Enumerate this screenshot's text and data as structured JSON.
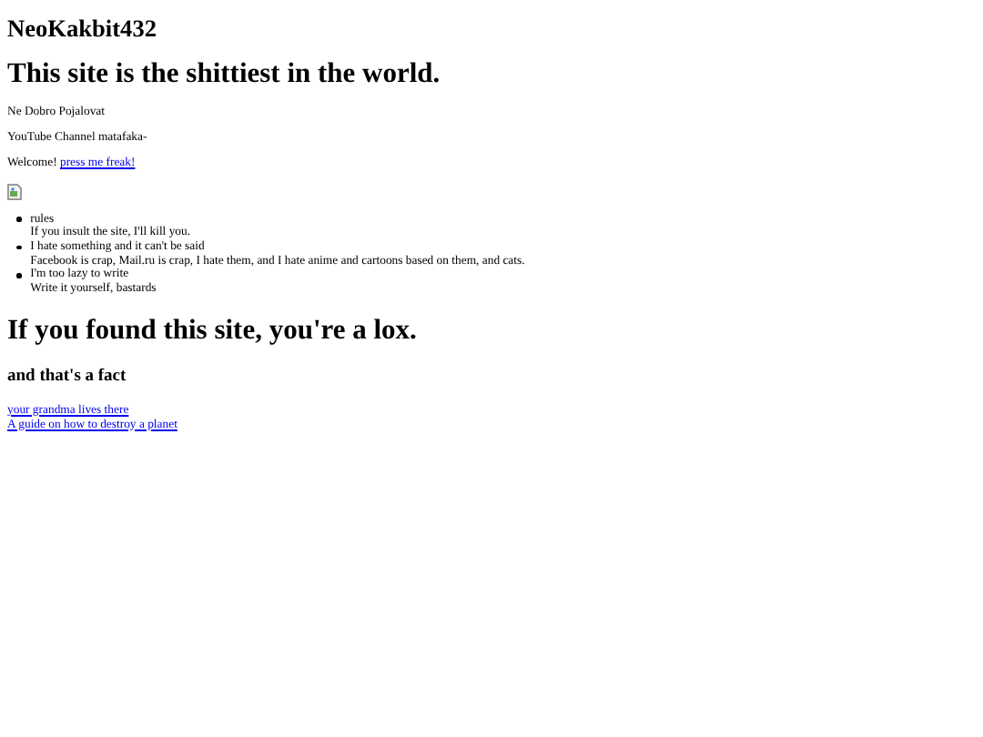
{
  "site_title": "NeoKakbit432",
  "headline": "This site is the shittiest in the world.",
  "paragraphs": [
    "Ne Dobro Pojalovat",
    "YouTube Channel matafaka-"
  ],
  "welcome": {
    "text": "Welcome!",
    "link": "press me freak!"
  },
  "list": [
    {
      "title": "rules",
      "text": "If you insult the site, I'll kill you."
    },
    {
      "title": "I hate something and it can't be said",
      "text": "Facebook is crap, Mail.ru is crap, I hate them, and I hate anime and cartoons based on them, and cats."
    },
    {
      "title": "I'm too lazy to write",
      "text": "Write it yourself, bastards"
    }
  ],
  "found_heading": "If you found this site, you're a lox.",
  "subheading": "and that's a fact",
  "links": [
    "your grandma lives there",
    "A guide on how to destroy a planet"
  ]
}
